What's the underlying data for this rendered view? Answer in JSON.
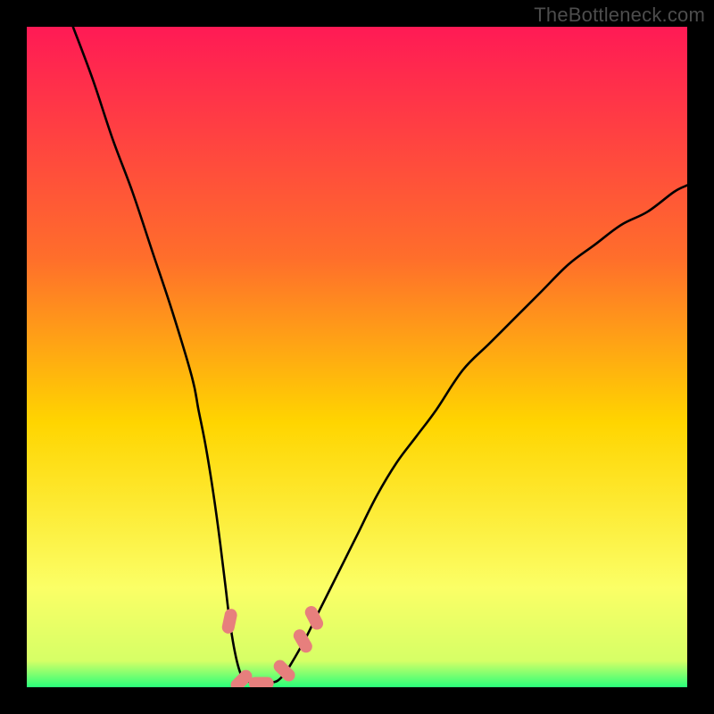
{
  "watermark": "TheBottleneck.com",
  "colors": {
    "frame_bg": "#000000",
    "gradient_top": "#ff1a55",
    "gradient_mid1": "#ff6e2b",
    "gradient_mid2": "#ffd500",
    "gradient_mid3": "#fbff66",
    "gradient_bottom": "#29ff7a",
    "curve": "#000000",
    "marker": "#e77f7d"
  },
  "chart_data": {
    "type": "line",
    "title": "",
    "xlabel": "",
    "ylabel": "",
    "xlim": [
      0,
      100
    ],
    "ylim": [
      0,
      100
    ],
    "grid": false,
    "series": [
      {
        "name": "bottleneck-curve",
        "x": [
          7,
          10,
          13,
          16,
          19,
          22,
          25,
          26,
          27,
          28,
          29,
          30,
          30.6,
          31.2,
          31.8,
          32.4,
          33,
          34,
          35,
          36,
          37,
          38,
          39,
          40,
          42,
          44,
          46,
          48,
          50,
          53,
          56,
          59,
          62,
          66,
          70,
          74,
          78,
          82,
          86,
          90,
          94,
          98,
          100
        ],
        "y": [
          100,
          92,
          83,
          75,
          66,
          57,
          47,
          42,
          37,
          31,
          24,
          16,
          11,
          7,
          4,
          2,
          1,
          0.8,
          0.6,
          0.6,
          0.7,
          1,
          2,
          3.5,
          7,
          11,
          15,
          19,
          23,
          29,
          34,
          38,
          42,
          48,
          52,
          56,
          60,
          64,
          67,
          70,
          72,
          75,
          76
        ]
      }
    ],
    "markers": [
      {
        "shape": "capsule",
        "x": 30.7,
        "y": 10.0,
        "angle": -78
      },
      {
        "shape": "capsule",
        "x": 32.5,
        "y": 1.0,
        "angle": -45
      },
      {
        "shape": "capsule",
        "x": 35.5,
        "y": 0.6,
        "angle": 0
      },
      {
        "shape": "capsule",
        "x": 39.0,
        "y": 2.5,
        "angle": 45
      },
      {
        "shape": "capsule",
        "x": 41.8,
        "y": 7.0,
        "angle": 60
      },
      {
        "shape": "capsule",
        "x": 43.5,
        "y": 10.5,
        "angle": 63
      }
    ],
    "minimum_x": 35.5
  }
}
